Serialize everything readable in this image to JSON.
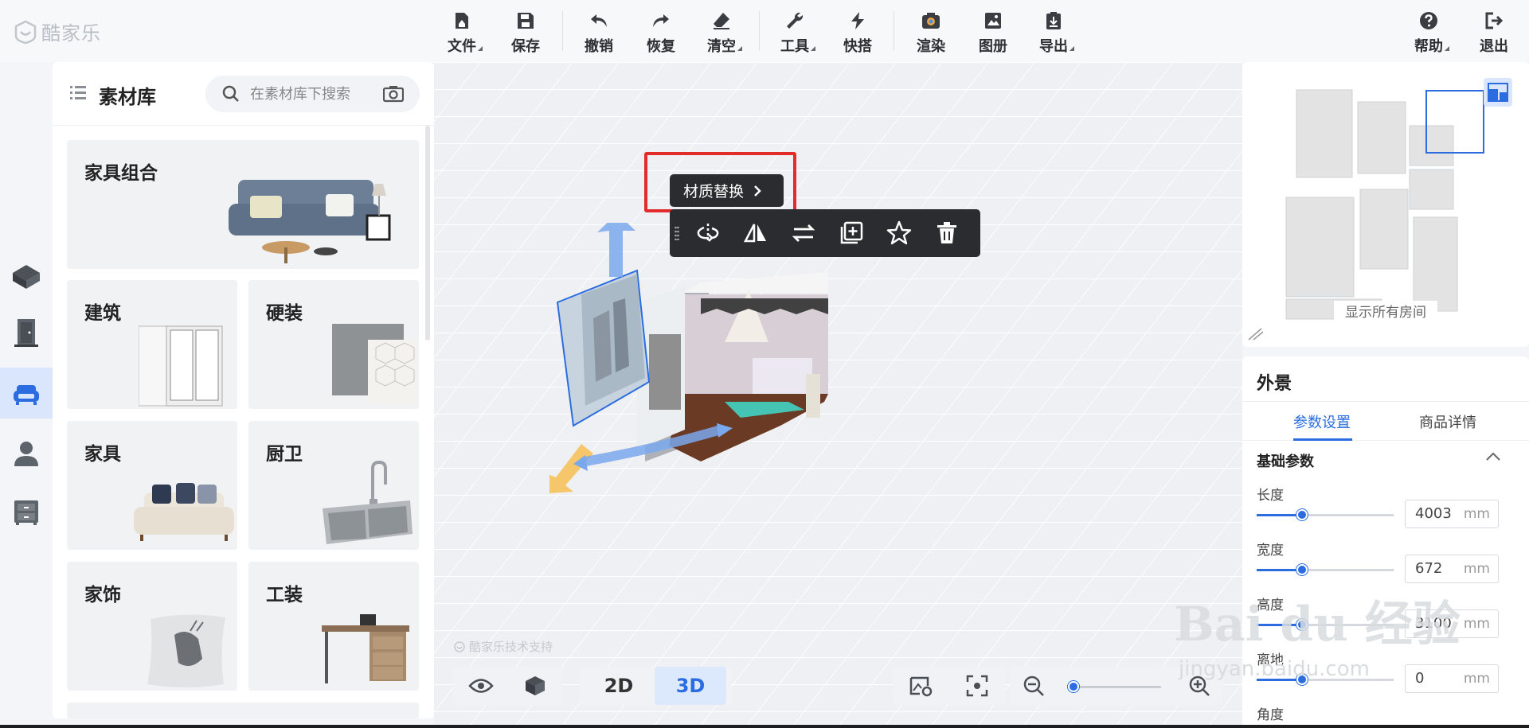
{
  "app": {
    "name": "酷家乐"
  },
  "toolbar": {
    "file": "文件",
    "save": "保存",
    "undo": "撤销",
    "redo": "恢复",
    "clear": "清空",
    "tools": "工具",
    "quick": "快搭",
    "render": "渲染",
    "album": "图册",
    "export": "导出",
    "help": "帮助",
    "exit": "退出"
  },
  "library": {
    "title": "素材库",
    "search_placeholder": "在素材库下搜索",
    "cards": {
      "furniture_set": "家具组合",
      "architecture": "建筑",
      "hard_decor": "硬装",
      "furniture": "家具",
      "kitchen_bath": "厨卫",
      "home_decor": "家饰",
      "tooling": "工装"
    }
  },
  "scene": {
    "material_replace": "材质替换",
    "object_tools": [
      "rotate-icon",
      "mirror-icon",
      "replace-icon",
      "duplicate-icon",
      "favorite-icon",
      "delete-icon"
    ]
  },
  "minimap": {
    "show_all_rooms": "显示所有房间"
  },
  "properties": {
    "title": "外景",
    "tabs": {
      "params": "参数设置",
      "detail": "商品详情"
    },
    "section": "基础参数",
    "rows": [
      {
        "label": "长度",
        "value": "4003",
        "unit": "mm",
        "level": 0.33
      },
      {
        "label": "宽度",
        "value": "672",
        "unit": "mm",
        "level": 0.33
      },
      {
        "label": "高度",
        "value": "3100",
        "unit": "mm",
        "level": 0.33
      },
      {
        "label": "离地",
        "value": "0",
        "unit": "mm",
        "level": 0.33
      },
      {
        "label": "角度",
        "value": "",
        "unit": "",
        "level": 0
      }
    ]
  },
  "bottom": {
    "view2d": "2D",
    "view3d": "3D",
    "zoom_level": 0.0,
    "powered": "酷家乐技术支持"
  },
  "watermark": {
    "brand": "Bai du 经验",
    "url": "jingyan.baidu.com"
  },
  "colors": {
    "accent": "#2b6de0",
    "highlight": "#e22b2b",
    "dark": "#2a2c30"
  }
}
